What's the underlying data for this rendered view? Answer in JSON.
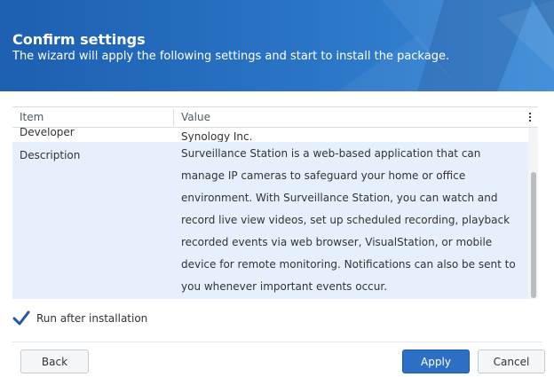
{
  "header": {
    "title": "Confirm settings",
    "subtitle": "The wizard will apply the following settings and start to install the package."
  },
  "table": {
    "columns": [
      "Item",
      "Value"
    ],
    "rows": [
      {
        "item": "Developer",
        "value": "Synology Inc."
      },
      {
        "item": "Description",
        "value": "Surveillance Station is a web-based application that can manage IP cameras to safeguard your home or office environment. With Surveillance Station, you can watch and record live view videos, set up scheduled recording, playback recorded events via web browser, VisualStation, or mobile device for remote monitoring. Notifications can also be sent to you whenever important events occur."
      }
    ]
  },
  "options": {
    "run_after_install": {
      "label": "Run after installation",
      "checked": true
    }
  },
  "footer": {
    "back": "Back",
    "apply": "Apply",
    "cancel": "Cancel"
  },
  "colors": {
    "header_blue": "#2a74c6",
    "selected_row": "#e6f0fc",
    "primary_button": "#2d6fc4",
    "checkmark": "#1f5aa6"
  },
  "icons": {
    "column_menu": "column-menu-icon",
    "checkbox": "checkmark-icon"
  }
}
